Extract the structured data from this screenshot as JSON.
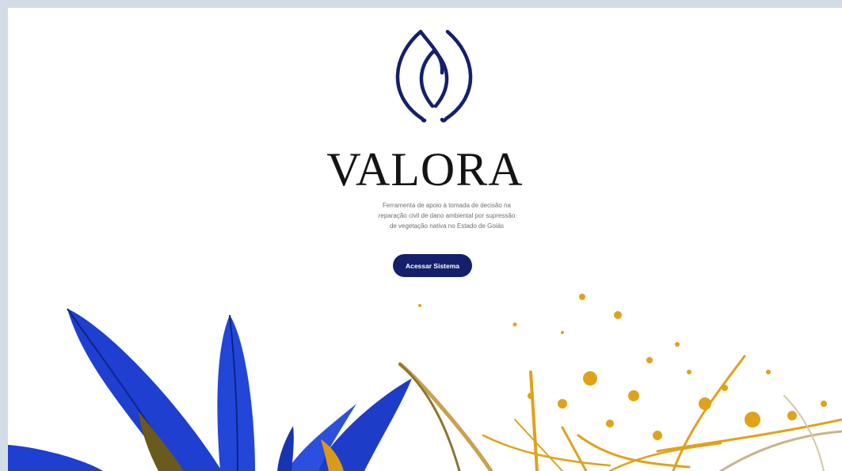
{
  "brand": {
    "name": "VALORA",
    "tagline_lines": [
      "Ferramenta de apoio à tomada de decisão na",
      "reparação civil de dano ambiental por supressão",
      "de vegetação nativa no Estado de Goiás"
    ]
  },
  "cta": {
    "label": "Acessar Sistema"
  },
  "colors": {
    "brand_navy": "#14206b",
    "page_bg": "#ffffff",
    "outer_bg": "#d3dde8",
    "leaf_blue": "#1e3fd0",
    "straw_gold": "#e0a21a"
  },
  "icons": {
    "logo": "leaf-mark-icon"
  }
}
